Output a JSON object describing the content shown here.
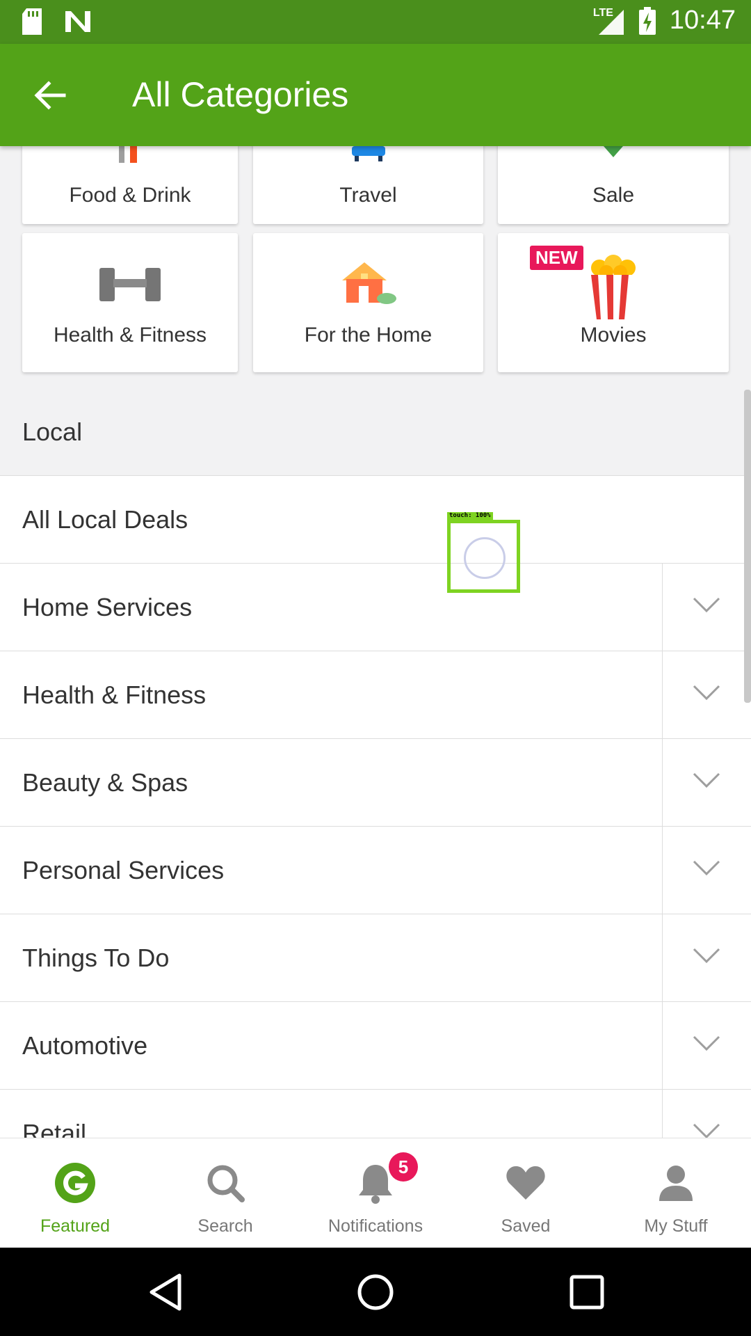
{
  "status_bar": {
    "time": "10:47",
    "network": "LTE"
  },
  "app_bar": {
    "title": "All Categories"
  },
  "categories_top": [
    {
      "label": "Food & Drink",
      "icon": "food-icon"
    },
    {
      "label": "Travel",
      "icon": "travel-icon"
    },
    {
      "label": "Sale",
      "icon": "sale-icon"
    }
  ],
  "categories_row2": [
    {
      "label": "Health & Fitness",
      "icon": "dumbbell-icon"
    },
    {
      "label": "For the Home",
      "icon": "house-icon"
    },
    {
      "label": "Movies",
      "icon": "popcorn-icon",
      "badge": "NEW"
    }
  ],
  "local": {
    "title": "Local",
    "items": [
      {
        "label": "All Local Deals"
      },
      {
        "label": "Home Services"
      },
      {
        "label": "Health & Fitness"
      },
      {
        "label": "Beauty & Spas"
      },
      {
        "label": "Personal Services"
      },
      {
        "label": "Things To Do"
      },
      {
        "label": "Automotive"
      },
      {
        "label": "Retail"
      }
    ]
  },
  "touch_indicator": {
    "label": "touch: 100%"
  },
  "bottom_nav": [
    {
      "label": "Featured",
      "icon": "groupon-g-icon",
      "active": true
    },
    {
      "label": "Search",
      "icon": "search-icon"
    },
    {
      "label": "Notifications",
      "icon": "bell-icon",
      "badge": "5"
    },
    {
      "label": "Saved",
      "icon": "heart-icon"
    },
    {
      "label": "My Stuff",
      "icon": "person-icon"
    }
  ],
  "colors": {
    "status_bar": "#4a8f1c",
    "app_bar": "#53a318",
    "accent": "#53a318",
    "badge": "#e8185a"
  }
}
